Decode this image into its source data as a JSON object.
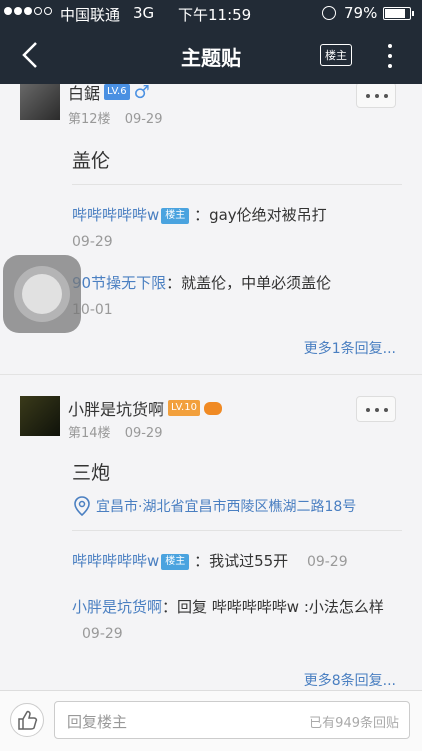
{
  "status": {
    "carrier": "中国联通",
    "network": "3G",
    "time": "下午11:59",
    "battery": "79%"
  },
  "nav": {
    "title": "主题贴",
    "owner_label": "楼主"
  },
  "posts": [
    {
      "username": "白鋸",
      "level": "LV.6",
      "floor": "第12楼",
      "date": "09-29",
      "text": "盖伦",
      "replies": [
        {
          "user": "哔哔哔哔哔w",
          "tag": "楼主",
          "text": "：gay伦绝对被吊打",
          "date": "09-29"
        },
        {
          "user": "90节操无下限",
          "text": "：就盖伦，中单必须盖伦",
          "date": "10-01"
        }
      ],
      "more": "更多1条回复..."
    },
    {
      "username": "小胖是坑货啊",
      "level": "LV.10",
      "floor": "第14楼",
      "date": "09-29",
      "text": "三炮",
      "location": "宜昌市·湖北省宜昌市西陵区樵湖二路18号",
      "replies": [
        {
          "user": "哔哔哔哔哔w",
          "tag": "楼主",
          "text": "：我试过55开",
          "date": "09-29"
        },
        {
          "user": "小胖是坑货啊",
          "text": "：回复 哔哔哔哔哔w :小法怎么样",
          "date": "09-29"
        }
      ],
      "more": "更多8条回复..."
    }
  ],
  "bottom": {
    "placeholder": "回复楼主",
    "count": "已有949条回贴"
  }
}
